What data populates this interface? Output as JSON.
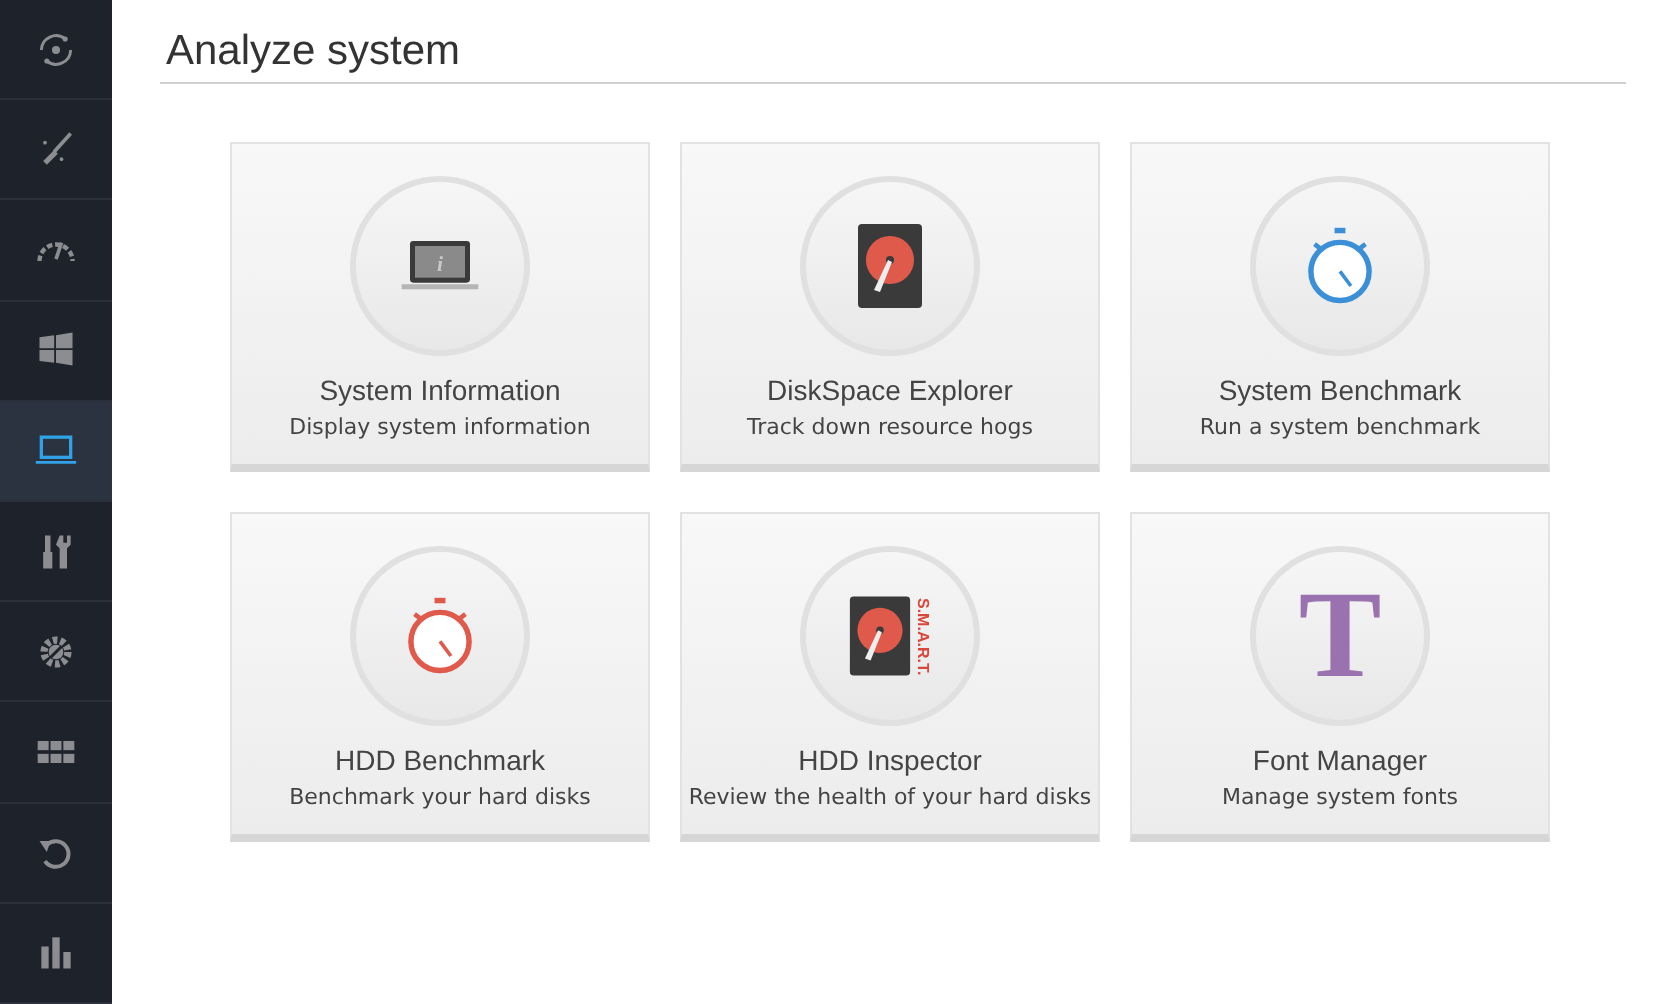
{
  "sidebar": {
    "items": [
      {
        "kind": "orbit",
        "selected": false
      },
      {
        "kind": "broom",
        "selected": false
      },
      {
        "kind": "gauge",
        "selected": false
      },
      {
        "kind": "windows",
        "selected": false
      },
      {
        "kind": "laptop",
        "selected": true
      },
      {
        "kind": "tools",
        "selected": false
      },
      {
        "kind": "gear",
        "selected": false
      },
      {
        "kind": "grid",
        "selected": false
      },
      {
        "kind": "undo",
        "selected": false
      },
      {
        "kind": "bars",
        "selected": false
      }
    ]
  },
  "page": {
    "title": "Analyze system"
  },
  "tiles": [
    {
      "kind": "laptop",
      "icon_text": "i",
      "title": "System Information",
      "subtitle": "Display system information"
    },
    {
      "kind": "disk",
      "title": "DiskSpace Explorer",
      "subtitle": "Track down resource hogs"
    },
    {
      "kind": "stopwatch",
      "color": "#3a8fd6",
      "title": "System Benchmark",
      "subtitle": "Run a system benchmark"
    },
    {
      "kind": "stopwatch",
      "color": "#e05a4b",
      "title": "HDD Benchmark",
      "subtitle": "Benchmark your hard disks"
    },
    {
      "kind": "smart",
      "icon_text": "S.M.A.R.T.",
      "title": "HDD Inspector",
      "subtitle": "Review the health of your hard disks"
    },
    {
      "kind": "font",
      "icon_text": "T",
      "title": "Font Manager",
      "subtitle": "Manage system fonts"
    }
  ]
}
